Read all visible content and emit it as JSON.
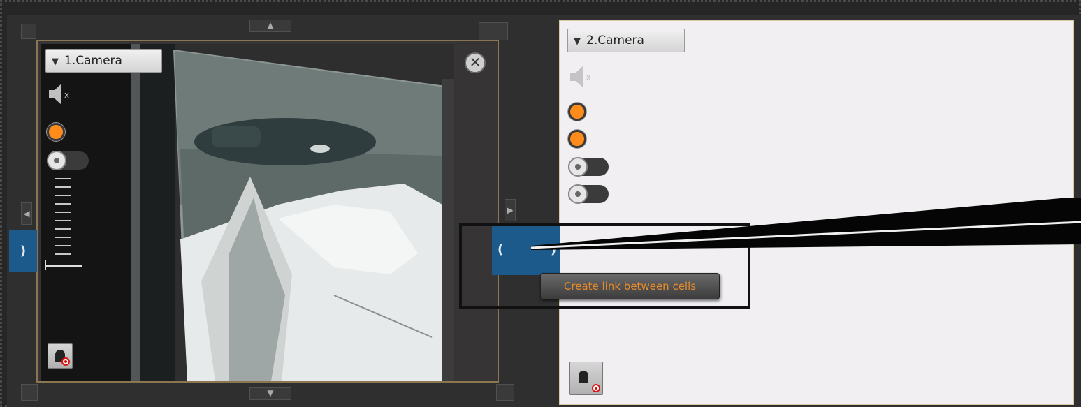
{
  "cells": [
    {
      "camera_label": "1.Camera",
      "controls": {
        "mute_icon": "speaker-muted-icon",
        "record_indicator": "orange-dot",
        "toggle": "off",
        "close_icon": "close-icon",
        "alarm_icon": "alarm-record-icon"
      }
    },
    {
      "camera_label": "2.Camera",
      "controls": {
        "mute_icon": "speaker-muted-icon",
        "record_indicators": 2,
        "toggles": 2,
        "alarm_icon": "alarm-record-icon"
      }
    }
  ],
  "link_button": {
    "left_glyph": "(",
    "right_glyph": ")",
    "tooltip": "Create link between cells"
  },
  "colors": {
    "accent_orange": "#ff8c1a",
    "link_blue": "#1c5a8c",
    "tooltip_text": "#e88b2a",
    "cell_border": "#8a7650"
  }
}
